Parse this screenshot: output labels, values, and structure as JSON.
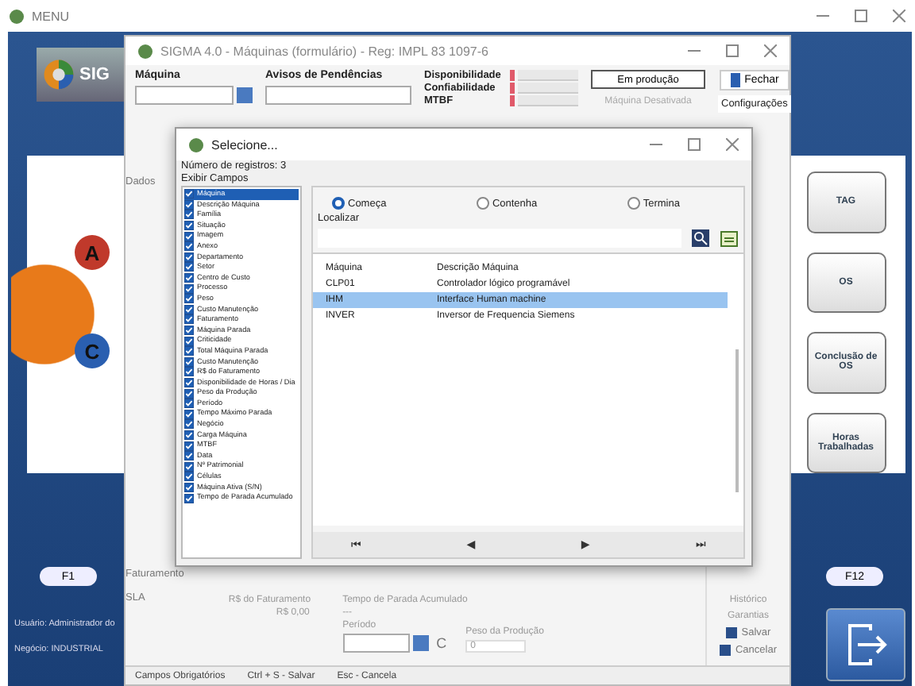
{
  "menu_window": {
    "title": "MENU",
    "logo_text": "SIG",
    "gear_letters": [
      "A",
      "C"
    ],
    "shortcuts": [
      "TAG",
      "OS",
      "Conclusão de OS",
      "Horas Trabalhadas"
    ],
    "function_keys": [
      "F1",
      "F12"
    ],
    "user": "Usuário: Administrador do",
    "business": "Negócio: INDUSTRIAL"
  },
  "machine_window": {
    "title": "SIGMA 4.0 - Máquinas (formulário) - Reg: IMPL 83 1097-6",
    "machine_label": "Máquina",
    "alerts_label": "Avisos de Pendências",
    "indicators": [
      "Disponibilidade",
      "Confiabilidade",
      "MTBF"
    ],
    "status_button": "Em produção",
    "inactive_button": {
      "label": "Máquina Desativada",
      "disabled": true
    },
    "close_button": "Fechar",
    "config_tab": "Configurações",
    "left_labels": [
      "Dados",
      "Faturamento",
      "SLA"
    ],
    "side_items": [
      "Histórico",
      "Garantias"
    ],
    "revenue_label": "R$ do Faturamento",
    "revenue_value": "R$ 0,00",
    "downtime_label": "Tempo de Parada Acumulado",
    "downtime_value": "---",
    "period_label": "Período",
    "period_button": "C",
    "weight_label": "Peso da Produção",
    "weight_value": "0",
    "save_button": "Salvar",
    "cancel_button": "Cancelar",
    "status_bar": [
      "Campos Obrigatórios",
      "Ctrl + S - Salvar",
      "Esc - Cancela"
    ]
  },
  "select_dialog": {
    "title": "Selecione...",
    "record_count": "Número de registros: 3",
    "fields_label": "Exibir Campos",
    "fields": [
      {
        "label": "Máquina",
        "checked": true,
        "selected": true
      },
      {
        "label": "Descrição Máquina",
        "checked": true,
        "selected": false
      },
      {
        "label": "Família",
        "checked": true,
        "selected": false
      },
      {
        "label": "Situação",
        "checked": true,
        "selected": false
      },
      {
        "label": "Imagem",
        "checked": true,
        "selected": false
      },
      {
        "label": "Anexo",
        "checked": true,
        "selected": false
      },
      {
        "label": "Departamento",
        "checked": true,
        "selected": false
      },
      {
        "label": "Setor",
        "checked": true,
        "selected": false
      },
      {
        "label": "Centro de Custo",
        "checked": true,
        "selected": false
      },
      {
        "label": "Processo",
        "checked": true,
        "selected": false
      },
      {
        "label": "Peso",
        "checked": true,
        "selected": false
      },
      {
        "label": "Custo Manutenção",
        "checked": true,
        "selected": false
      },
      {
        "label": "Faturamento",
        "checked": true,
        "selected": false
      },
      {
        "label": "Máquina Parada",
        "checked": true,
        "selected": false
      },
      {
        "label": "Criticidade",
        "checked": true,
        "selected": false
      },
      {
        "label": "Total Máquina Parada",
        "checked": true,
        "selected": false
      },
      {
        "label": "Custo Manutenção",
        "checked": true,
        "selected": false
      },
      {
        "label": "R$ do Faturamento",
        "checked": true,
        "selected": false
      },
      {
        "label": "Disponibilidade de Horas / Dia",
        "checked": true,
        "selected": false
      },
      {
        "label": "Peso da Produção",
        "checked": true,
        "selected": false
      },
      {
        "label": "Período",
        "checked": true,
        "selected": false
      },
      {
        "label": "Tempo Máximo Parada",
        "checked": true,
        "selected": false
      },
      {
        "label": "Negócio",
        "checked": true,
        "selected": false
      },
      {
        "label": "Carga Máquina",
        "checked": true,
        "selected": false
      },
      {
        "label": "MTBF",
        "checked": true,
        "selected": false
      },
      {
        "label": "Data",
        "checked": true,
        "selected": false
      },
      {
        "label": "Nº Patrimonial",
        "checked": true,
        "selected": false
      },
      {
        "label": "Células",
        "checked": true,
        "selected": false
      },
      {
        "label": "Máquina Ativa (S/N)",
        "checked": true,
        "selected": false
      },
      {
        "label": "Tempo de Parada Acumulado",
        "checked": true,
        "selected": false
      }
    ],
    "match_options": [
      {
        "label": "Começa",
        "selected": true
      },
      {
        "label": "Contenha",
        "selected": false
      },
      {
        "label": "Termina",
        "selected": false
      }
    ],
    "search_label": "Localizar",
    "columns": [
      "Máquina",
      "Descrição Máquina"
    ],
    "rows": [
      {
        "cells": [
          "CLP01",
          "Controlador lógico programável"
        ],
        "selected": false
      },
      {
        "cells": [
          "IHM",
          "Interface Human machine"
        ],
        "selected": true
      },
      {
        "cells": [
          "INVER",
          "Inversor de Frequencia Siemens"
        ],
        "selected": false
      }
    ],
    "nav_buttons": [
      "⏮",
      "◀",
      "▶",
      "⏭"
    ]
  }
}
